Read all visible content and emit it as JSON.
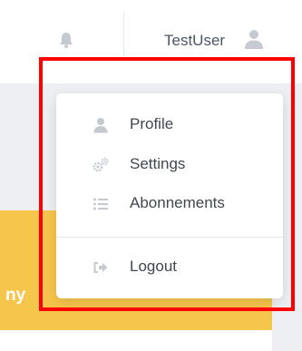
{
  "header": {
    "notification_icon": "bell-icon",
    "username": "TestUser",
    "avatar_icon": "user-icon"
  },
  "colors": {
    "accent": "#f6c54b",
    "highlight": "#ff0000",
    "icon_gray": "#c5cad1"
  },
  "background_card": {
    "title_fragment": "ny"
  },
  "dropdown": {
    "items": [
      {
        "label": "Profile",
        "icon": "user-icon"
      },
      {
        "label": "Settings",
        "icon": "gears-icon"
      },
      {
        "label": "Abonnements",
        "icon": "list-icon"
      }
    ],
    "logout": {
      "label": "Logout",
      "icon": "sign-out-icon"
    }
  }
}
